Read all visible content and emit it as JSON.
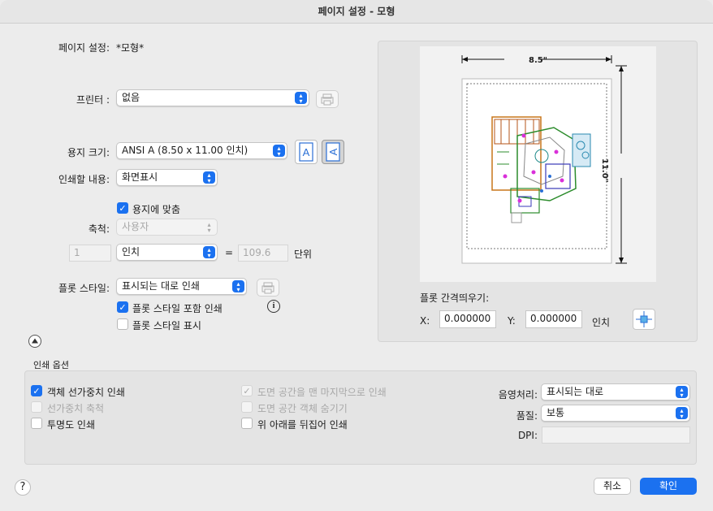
{
  "window": {
    "title": "페이지 설정 - 모형"
  },
  "page_setup": {
    "label": "페이지 설정:",
    "value": "*모형*"
  },
  "printer": {
    "label": "프린터 :",
    "value": "없음"
  },
  "paper_size": {
    "label": "용지 크기:",
    "value": "ANSI A (8.50 x 11.00 인치)"
  },
  "plot_area": {
    "label": "인쇄할 내용:",
    "value": "화면표시"
  },
  "fit_to_paper": {
    "label": "용지에 맞춤",
    "checked": true
  },
  "scale": {
    "label": "축척:",
    "value": "사용자",
    "num": "1",
    "unit": "인치",
    "equals": "=",
    "units_value": "109.6",
    "units_label": "단위"
  },
  "plot_style": {
    "label": "플롯 스타일:",
    "value": "표시되는 대로 인쇄",
    "include_label": "플롯 스타일 포함 인쇄",
    "include_checked": true,
    "display_label": "플롯 스타일 표시",
    "display_checked": false
  },
  "preview": {
    "width_label": "8.5\"",
    "height_label": "11.0\""
  },
  "plot_offset": {
    "label": "플롯 간격띄우기:",
    "x_label": "X:",
    "x_value": "0.000000",
    "y_label": "Y:",
    "y_value": "0.000000",
    "unit": "인치"
  },
  "print_options": {
    "title": "인쇄 옵션",
    "lineweights": {
      "label": "객체 선가중치 인쇄",
      "checked": true
    },
    "scale_lineweights": {
      "label": "선가중치 축척",
      "checked": false,
      "disabled": true
    },
    "transparency": {
      "label": "투명도 인쇄",
      "checked": false
    },
    "paperspace_last": {
      "label": "도면 공간을 맨 마지막으로 인쇄",
      "checked": true,
      "disabled": true
    },
    "hide_paperspace": {
      "label": "도면 공간 객체 숨기기",
      "checked": false,
      "disabled": true
    },
    "upside_down": {
      "label": "위 아래를 뒤집어 인쇄",
      "checked": false
    },
    "shading": {
      "label": "음영처리:",
      "value": "표시되는 대로"
    },
    "quality": {
      "label": "품질:",
      "value": "보통"
    },
    "dpi": {
      "label": "DPI:",
      "value": ""
    }
  },
  "buttons": {
    "help": "?",
    "cancel": "취소",
    "ok": "확인"
  },
  "icons": {
    "collapse": "chevron-up-icon",
    "info": "info-icon",
    "center": "center-plot-icon",
    "printer_props": "printer-properties-icon",
    "portrait": "portrait-icon",
    "landscape": "landscape-icon"
  },
  "colors": {
    "accent": "#1b71f0"
  }
}
